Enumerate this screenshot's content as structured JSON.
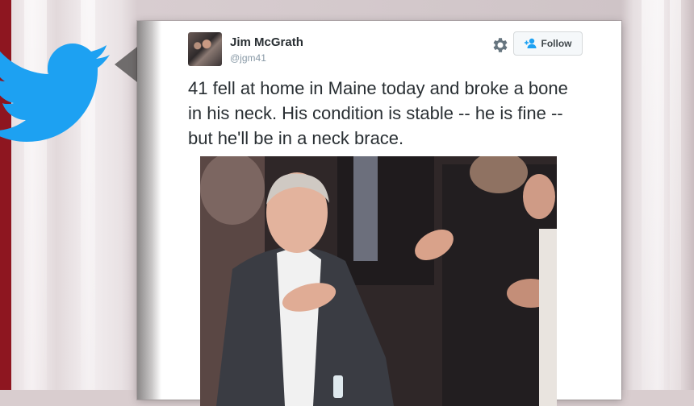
{
  "tweet": {
    "author_name": "Jim McGrath",
    "author_handle": "@jgm41",
    "text": "41 fell at home in Maine today and broke a bone in his neck. His condition is stable -- he is fine -- but he'll be in a neck brace.",
    "follow_label": "Follow"
  },
  "icons": {
    "brand": "twitter-bird-icon",
    "settings": "gear-icon",
    "follow": "add-user-icon"
  },
  "colors": {
    "twitter_blue": "#1da1f2",
    "broadcast_red": "#8e1620",
    "text": "#292f33",
    "handle": "#8899a6"
  }
}
